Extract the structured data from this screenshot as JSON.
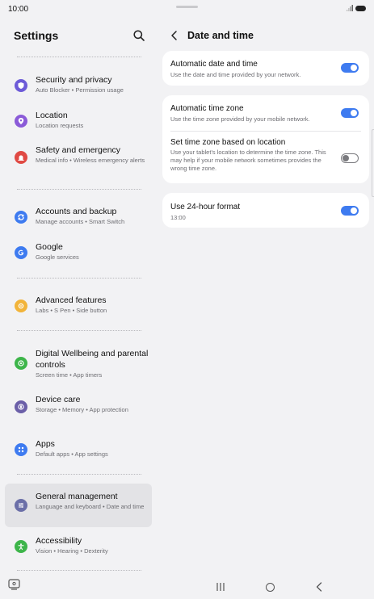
{
  "status": {
    "time": "10:00"
  },
  "settings": {
    "title": "Settings",
    "items": [
      {
        "title": "Security and privacy",
        "subtitle": "Auto Blocker • Permission usage",
        "icon": "shield-icon",
        "color": "#6d5bd8"
      },
      {
        "title": "Location",
        "subtitle": "Location requests",
        "icon": "location-pin-icon",
        "color": "#8b5bd8"
      },
      {
        "title": "Safety and emergency",
        "subtitle": "Medical info • Wireless emergency alerts",
        "icon": "emergency-icon",
        "color": "#e04a44"
      },
      {
        "title": "Accounts and backup",
        "subtitle": "Manage accounts • Smart Switch",
        "icon": "sync-icon",
        "color": "#3e7bf0"
      },
      {
        "title": "Google",
        "subtitle": "Google services",
        "icon": "google-icon",
        "color": "#3e7bf0"
      },
      {
        "title": "Advanced features",
        "subtitle": "Labs • S Pen • Side button",
        "icon": "gear-plus-icon",
        "color": "#f2b43a"
      },
      {
        "title": "Digital Wellbeing and parental controls",
        "subtitle": "Screen time • App timers",
        "icon": "wellbeing-icon",
        "color": "#3db54a"
      },
      {
        "title": "Device care",
        "subtitle": "Storage • Memory • App protection",
        "icon": "device-care-icon",
        "color": "#6b5fa8"
      },
      {
        "title": "Apps",
        "subtitle": "Default apps • App settings",
        "icon": "apps-grid-icon",
        "color": "#3e7bf0"
      },
      {
        "title": "General management",
        "subtitle": "Language and keyboard • Date and time",
        "icon": "sliders-icon",
        "color": "#6b6fa8"
      },
      {
        "title": "Accessibility",
        "subtitle": "Vision • Hearing • Dexterity",
        "icon": "accessibility-icon",
        "color": "#3db54a"
      }
    ]
  },
  "date_time": {
    "title": "Date and time",
    "auto_date": {
      "title": "Automatic date and time",
      "subtitle": "Use the date and time provided by your network.",
      "on": true
    },
    "auto_zone": {
      "title": "Automatic time zone",
      "subtitle": "Use the time zone provided by your mobile network.",
      "on": true
    },
    "zone_location": {
      "title": "Set time zone based on location",
      "subtitle": "Use your tablet's location to determine the time zone. This may help if your mobile network sometimes provides the wrong time zone.",
      "on": false
    },
    "format24": {
      "title": "Use 24-hour format",
      "subtitle": "13:00",
      "on": true
    }
  },
  "colors": {
    "accent": "#3e7bf0",
    "background": "#f2f2f4",
    "card": "#ffffff",
    "selected": "#e3e3e6"
  }
}
